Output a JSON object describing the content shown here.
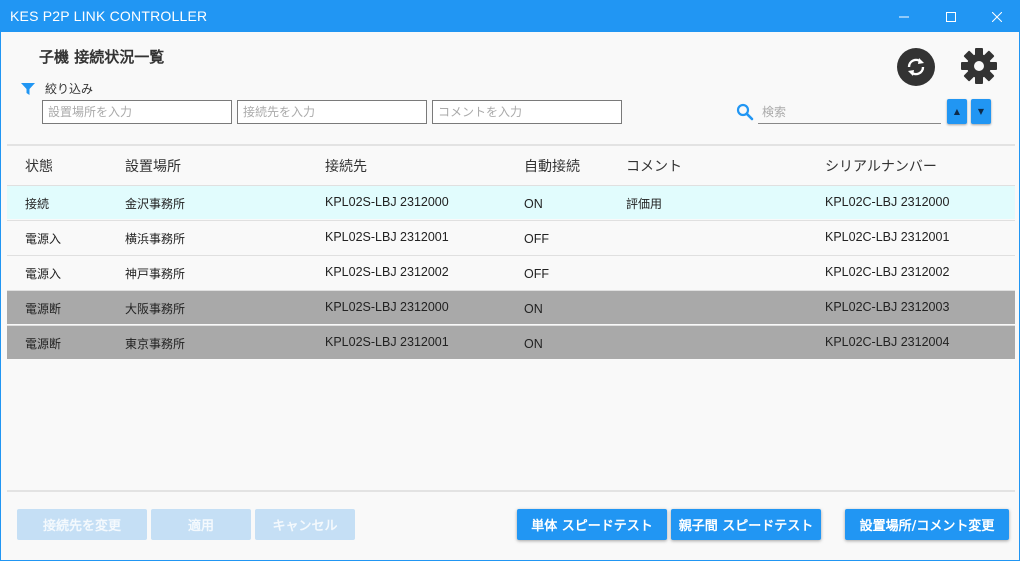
{
  "window": {
    "title": "KES P2P LINK CONTROLLER",
    "accent_color": "#2196f3"
  },
  "header": {
    "page_title": "子機 接続状況一覧"
  },
  "filter": {
    "label": "絞り込み",
    "location_placeholder": "設置場所を入力",
    "destination_placeholder": "接続先を入力",
    "comment_placeholder": "コメントを入力",
    "search_placeholder": "検索"
  },
  "table": {
    "headers": [
      "状態",
      "設置場所",
      "接続先",
      "自動接続",
      "コメント",
      "シリアルナンバー"
    ],
    "rows": [
      {
        "status": "接続",
        "location": "金沢事務所",
        "destination": "KPL02S-LBJ 2312000",
        "auto": "ON",
        "comment": "評価用",
        "serial": "KPL02C-LBJ 2312000"
      },
      {
        "status": "電源入",
        "location": "横浜事務所",
        "destination": "KPL02S-LBJ 2312001",
        "auto": "OFF",
        "comment": "",
        "serial": "KPL02C-LBJ 2312001"
      },
      {
        "status": "電源入",
        "location": "神戸事務所",
        "destination": "KPL02S-LBJ 2312002",
        "auto": "OFF",
        "comment": "",
        "serial": "KPL02C-LBJ 2312002"
      },
      {
        "status": "電源断",
        "location": "大阪事務所",
        "destination": "KPL02S-LBJ 2312000",
        "auto": "ON",
        "comment": "",
        "serial": "KPL02C-LBJ 2312003"
      },
      {
        "status": "電源断",
        "location": "東京事務所",
        "destination": "KPL02S-LBJ 2312001",
        "auto": "ON",
        "comment": "",
        "serial": "KPL02C-LBJ 2312004"
      }
    ]
  },
  "buttons": {
    "change_destination": "接続先を変更",
    "apply": "適用",
    "cancel": "キャンセル",
    "single_speed_test": "単体 スピードテスト",
    "parent_child_speed_test": "親子間 スピードテスト",
    "change_location_comment": "設置場所/コメント変更"
  },
  "icons": {
    "minimize": "minimize-icon",
    "maximize": "maximize-icon",
    "close": "close-icon",
    "refresh": "refresh-icon",
    "settings": "gear-icon",
    "filter": "filter-icon",
    "search": "search-icon",
    "up": "arrow-up-icon",
    "down": "arrow-down-icon"
  }
}
